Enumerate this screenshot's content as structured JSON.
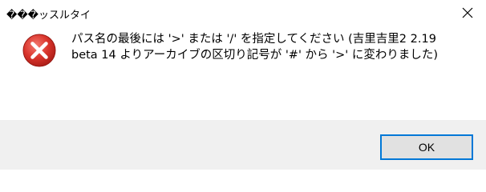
{
  "window": {
    "title": "���ッスルタイ"
  },
  "titlebar": {
    "close_icon": "close-icon"
  },
  "message": {
    "icon": "error-icon",
    "line1": "パス名の最後には '>' または '/' を指定してください (吉里吉里2 2.19",
    "line2": "beta 14 よりアーカイブの区切り記号が '#' から '>' に変わりました)"
  },
  "buttons": {
    "ok_label": "OK"
  },
  "colors": {
    "error_red": "#d9342b",
    "button_focus_border": "#0078d7",
    "footer_bg": "#f0f0f0",
    "button_bg": "#e1e1e1"
  }
}
